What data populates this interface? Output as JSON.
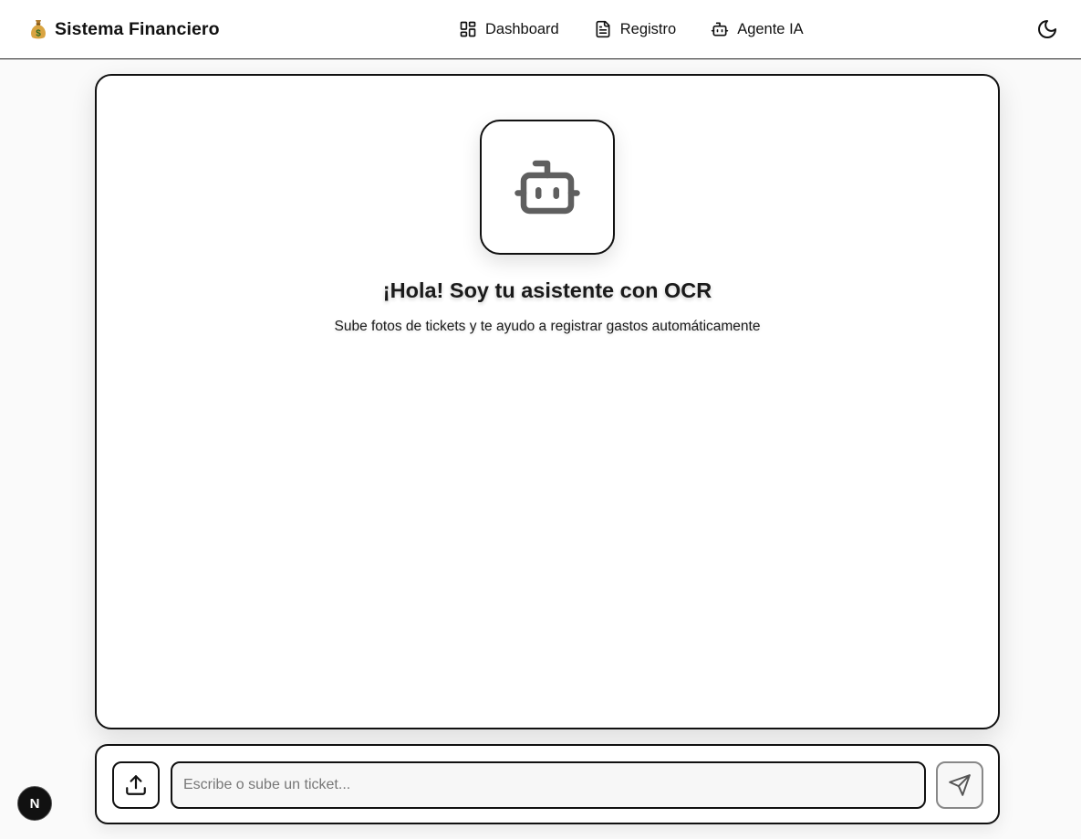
{
  "app": {
    "brand_icon": "money-bag-icon",
    "title": "Sistema Financiero"
  },
  "nav": {
    "items": [
      {
        "label": "Dashboard",
        "icon": "layout-dashboard-icon"
      },
      {
        "label": "Registro",
        "icon": "file-text-icon"
      },
      {
        "label": "Agente IA",
        "icon": "bot-icon"
      }
    ],
    "theme_toggle_icon": "moon-icon"
  },
  "chat": {
    "avatar_icon": "bot-icon",
    "welcome_title": "¡Hola! Soy tu asistente con OCR",
    "welcome_subtitle": "Sube fotos de tickets y te ayudo a registrar gastos automáticamente"
  },
  "composer": {
    "upload_icon": "upload-icon",
    "placeholder": "Escribe o sube un ticket...",
    "value": "",
    "send_icon": "send-icon"
  },
  "dev_badge": {
    "letter": "N"
  },
  "colors": {
    "border": "#111111",
    "background": "#fafafa",
    "panel": "#ffffff",
    "avatar_icon": "#5f5f5f"
  }
}
